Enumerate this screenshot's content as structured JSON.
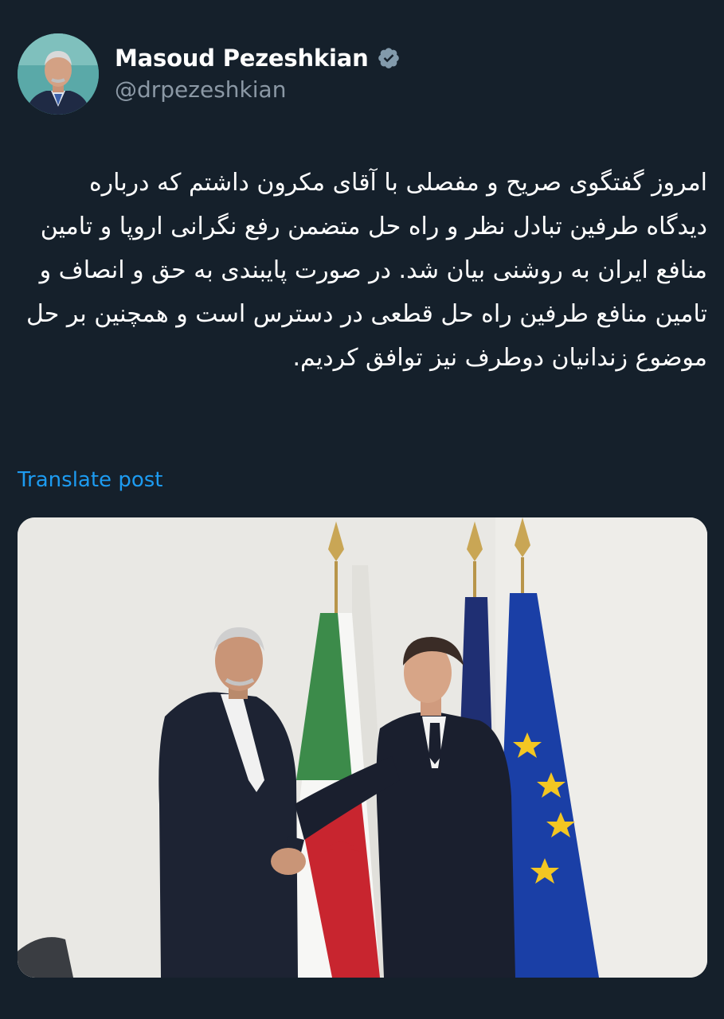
{
  "author": {
    "display_name": "Masoud Pezeshkian",
    "handle": "@drpezeshkian",
    "verified": true,
    "verified_icon": "verified-badge-icon"
  },
  "post": {
    "text": "امروز گفتگوی صریح و مفصلی با آقای مکرون داشتم که درباره دیدگاه طرفین تبادل نظر و راه حل متضمن رفع نگرانی اروپا و تامین منافع ایران به روشنی بیان شد. در صورت پایبندی به حق و انصاف و تامین منافع طرفین راه حل قطعی در دسترس است و همچنین بر حل موضوع زندانیان دوطرف نیز توافق کردیم.",
    "translate_label": "Translate post"
  },
  "colors": {
    "background": "#15202b",
    "text": "#ffffff",
    "secondary_text": "#8b98a5",
    "link": "#1d9bf0"
  }
}
